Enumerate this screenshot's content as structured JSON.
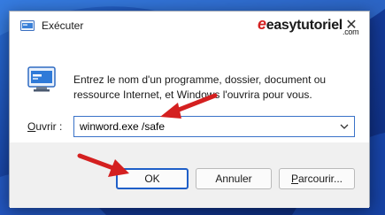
{
  "window": {
    "title": "Exécuter",
    "close_glyph": "✕"
  },
  "watermark": {
    "brand": "easytutoriel",
    "tld": ".com"
  },
  "body": {
    "description": "Entrez le nom d'un programme, dossier, document ou ressource Internet, et Windows l'ouvrira pour vous.",
    "open_label_accel": "O",
    "open_label_rest": "uvrir :",
    "open_value": "winword.exe /safe"
  },
  "buttons": {
    "ok": "OK",
    "cancel": "Annuler",
    "browse_accel": "P",
    "browse_rest": "arcourir..."
  },
  "icons": {
    "title": "run-icon",
    "large": "run-icon",
    "dropdown": "chevron-down-icon",
    "close": "close-icon"
  },
  "colors": {
    "accent": "#1f5fc8",
    "annotation_arrow": "#d42020",
    "wallpaper": "#1c4aa8"
  }
}
